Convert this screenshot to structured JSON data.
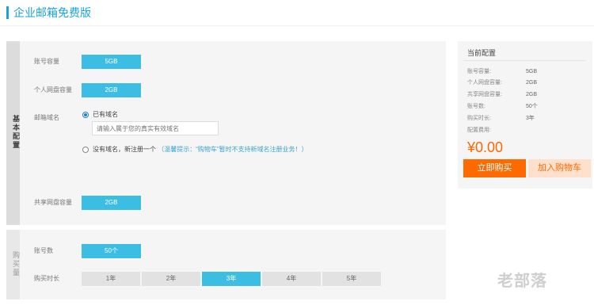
{
  "page": {
    "title": "企业邮箱免费版"
  },
  "basic_config": {
    "side_label": "基本配置",
    "account_capacity": {
      "label": "账号容量",
      "value": "5GB"
    },
    "personal_disk": {
      "label": "个人网盘容量",
      "value": "2GB"
    },
    "mail_domain": {
      "label": "邮箱域名",
      "option_has_domain": "已有域名",
      "domain_placeholder": "请输入属于您的真实有效域名",
      "option_no_domain": "没有域名，新注册一个",
      "tip": "（温馨提示：“购物车”暂时不支持新域名注册业务！）",
      "selected": "已有域名"
    },
    "shared_disk": {
      "label": "共享网盘容量",
      "value": "2GB"
    }
  },
  "purchase": {
    "side_label": "购买量",
    "accounts": {
      "label": "账号数",
      "value": "50个"
    },
    "duration": {
      "label": "购买时长",
      "options": [
        "1年",
        "2年",
        "3年",
        "4年",
        "5年"
      ],
      "selected": "3年"
    }
  },
  "current_config": {
    "title": "当前配置",
    "rows": [
      {
        "label": "账号容量:",
        "value": "5GB"
      },
      {
        "label": "个人网盘容量:",
        "value": "2GB"
      },
      {
        "label": "共享网盘容量:",
        "value": "2GB"
      },
      {
        "label": "账号数:",
        "value": "50个"
      },
      {
        "label": "购买时长:",
        "value": "3年"
      }
    ],
    "fee_label": "配置费用:",
    "price": "¥0.00",
    "buy_button": "立即购买",
    "cart_button": "加入购物车"
  },
  "watermark": "老部落",
  "colors": {
    "accent": "#1aa3d9",
    "option_blue": "#3cbde4",
    "price_orange": "#ff6600",
    "buy_orange": "#ff6a00",
    "cart_bg": "#ffe0cc"
  }
}
